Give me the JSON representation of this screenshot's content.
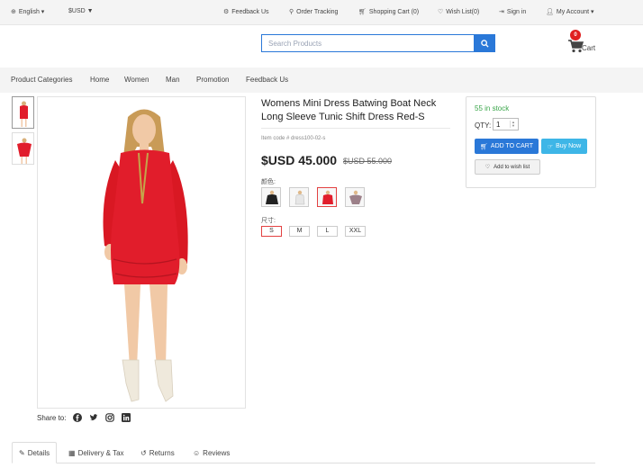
{
  "topbar": {
    "language": "English",
    "currency": "$USD",
    "feedback": "Feedback Us",
    "order_tracking": "Order Tracking",
    "shopping_cart": "Shopping Cart (0)",
    "wish_list": "Wish List(0)",
    "sign_in": "Sign in",
    "my_account": "My Account"
  },
  "header": {
    "search_placeholder": "Search Products",
    "cart_count": "0",
    "cart_label": "Cart"
  },
  "nav": {
    "items": [
      "Product Categories",
      "Home",
      "Women",
      "Man",
      "Promotion",
      "Feedback Us"
    ]
  },
  "product": {
    "title": "Womens Mini Dress Batwing Boat Neck Long Sleeve Tunic Shift Dress Red-S",
    "item_code": "Item code # dress100-02-s",
    "price": "$USD 45.000",
    "old_price": "$USD 55.000",
    "color_label": "颜色:",
    "size_label": "尺寸:",
    "sizes": [
      "S",
      "M",
      "L",
      "XXL"
    ],
    "selected_size": "S",
    "dress_color": "#e11d2b"
  },
  "buybox": {
    "stock": "55 in stock",
    "qty_label": "QTY:",
    "qty_value": "1",
    "add_to_cart": "ADD TO CART",
    "buy_now": "Buy Now",
    "add_wishlist": "Add to wish list"
  },
  "share": {
    "label": "Share to:",
    "networks": [
      "facebook-icon",
      "twitter-icon",
      "instagram-icon",
      "linkedin-icon"
    ]
  },
  "tabs": [
    {
      "label": "Details",
      "icon": "edit-icon"
    },
    {
      "label": "Delivery & Tax",
      "icon": "grid-icon"
    },
    {
      "label": "Returns",
      "icon": "returns-icon"
    },
    {
      "label": "Reviews",
      "icon": "reviews-icon"
    }
  ],
  "colors": {
    "accent": "#2a78d8",
    "buy_now": "#3eb6e7",
    "stock": "#3aa64a",
    "selected": "#e34141"
  }
}
